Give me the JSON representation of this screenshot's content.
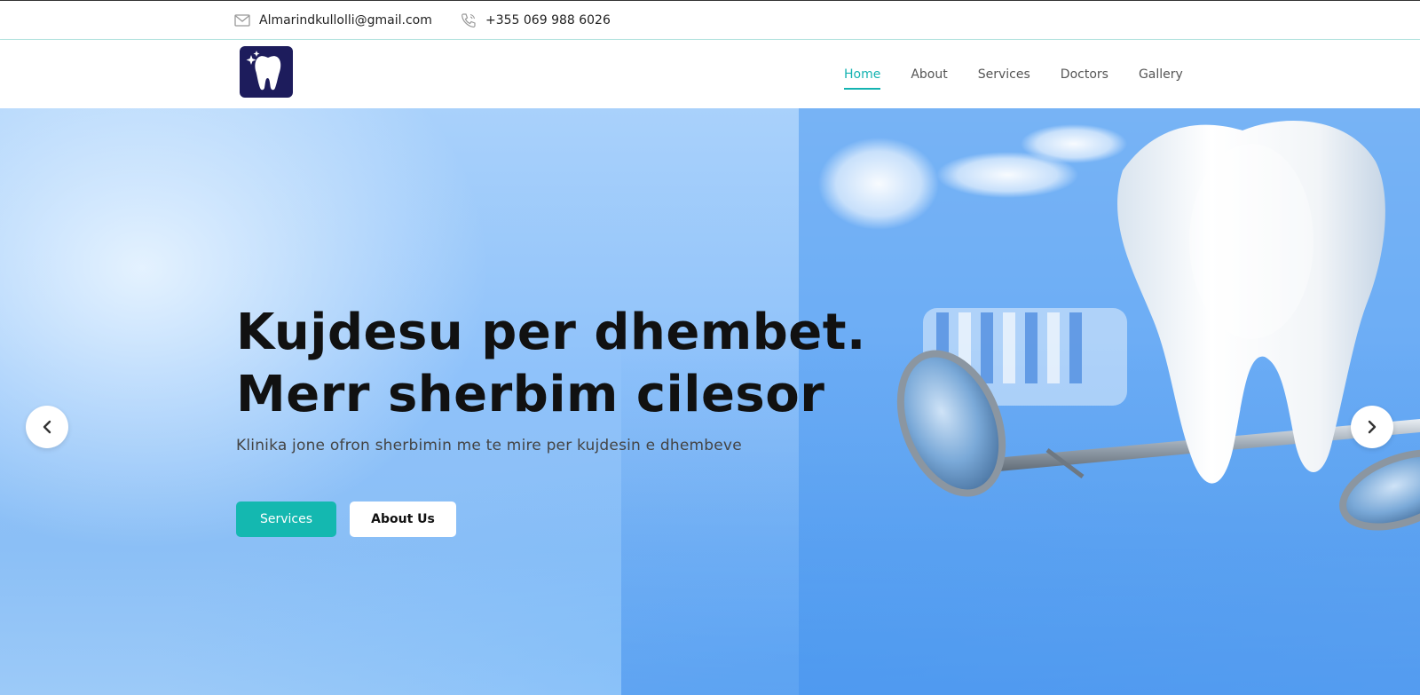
{
  "topbar": {
    "email": "Almarindkullolli@gmail.com",
    "phone": "+355 069 988 6026",
    "email_icon": "envelope-icon",
    "phone_icon": "phone-icon"
  },
  "nav": {
    "logo_icon": "tooth-logo-icon",
    "items": [
      {
        "label": "Home",
        "active": true
      },
      {
        "label": "About",
        "active": false
      },
      {
        "label": "Services",
        "active": false
      },
      {
        "label": "Doctors",
        "active": false
      },
      {
        "label": "Gallery",
        "active": false
      }
    ]
  },
  "hero": {
    "title_line1": "Kujdesu per dhembet.",
    "title_line2": "Merr sherbim cilesor",
    "subtitle": "Klinika jone ofron sherbimin me te mire per kujdesin e dhembeve",
    "primary_button": "Services",
    "secondary_button": "About Us",
    "prev_icon": "chevron-left-icon",
    "next_icon": "chevron-right-icon"
  },
  "colors": {
    "accent": "#14b8b0",
    "logo_bg": "#1d1c5c",
    "hero_blue": "#8fc2fa"
  }
}
